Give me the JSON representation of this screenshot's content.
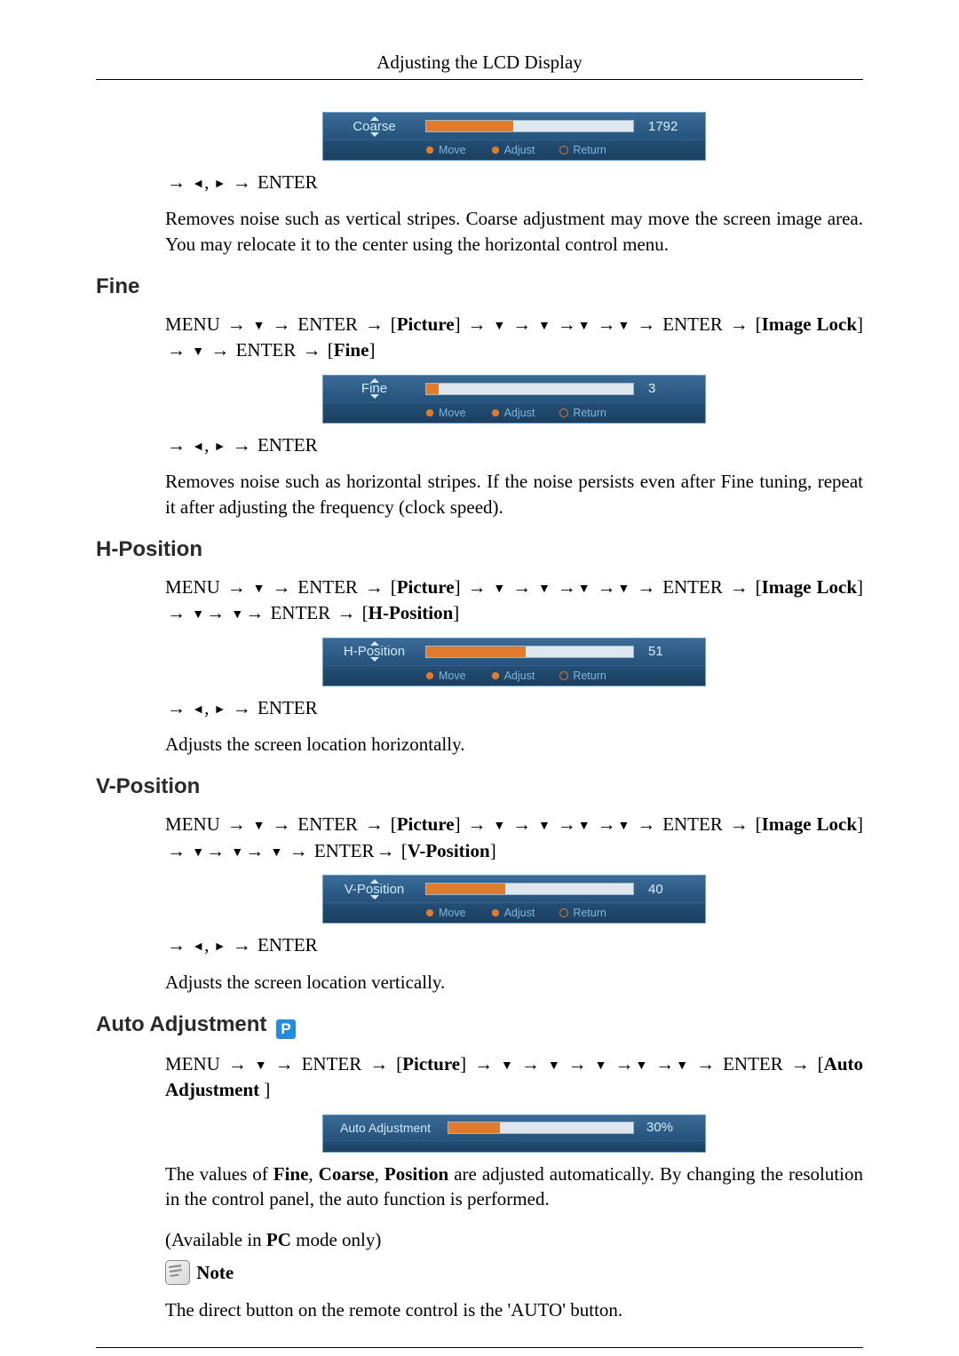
{
  "header": {
    "title": "Adjusting the LCD Display"
  },
  "glyphs": {
    "arrow_right": "→",
    "tri_down": "▼",
    "tri_left": "◄",
    "tri_right": "►",
    "comma": ","
  },
  "common": {
    "menu": "MENU",
    "enter": "ENTER",
    "picture": "Picture",
    "image_lock": "Image Lock"
  },
  "osd_hints": {
    "move": "Move",
    "adjust": "Adjust",
    "ret": "Return"
  },
  "coarse": {
    "osd": {
      "label": "Coarse",
      "value": "1792",
      "fill_pct": 42
    },
    "post_enter": "ENTER",
    "desc": "Removes noise such as vertical stripes. Coarse adjustment may move the screen image area. You may relocate it to the center using the horizontal control menu."
  },
  "fine": {
    "heading": "Fine",
    "bracket": "Fine",
    "osd": {
      "label": "Fine",
      "value": "3",
      "fill_pct": 6
    },
    "post_enter": "ENTER",
    "desc": "Removes noise such as horizontal stripes. If the noise persists even after Fine tuning, repeat it after adjusting the frequency (clock speed)."
  },
  "hpos": {
    "heading": "H-Position",
    "bracket": "H-Position",
    "osd": {
      "label": "H-Position",
      "value": "51",
      "fill_pct": 48
    },
    "post_enter": "ENTER",
    "desc": "Adjusts the screen location horizontally."
  },
  "vpos": {
    "heading": "V-Position",
    "bracket": "V-Position",
    "osd": {
      "label": "V-Position",
      "value": "40",
      "fill_pct": 38
    },
    "post_enter": "ENTER",
    "desc": "Adjusts the screen location vertically."
  },
  "auto": {
    "heading": "Auto Adjustment",
    "bracket": "Auto Adjustment ",
    "osd": {
      "label": "Auto Adjustment",
      "value": "30%",
      "fill_pct": 28
    },
    "desc_pre": "The values of ",
    "desc_b1": "Fine",
    "desc_mid1": ", ",
    "desc_b2": "Coarse",
    "desc_mid2": ", ",
    "desc_b3": "Position",
    "desc_post": " are adjusted automatically. By changing the resolution in the control panel, the auto function is performed.",
    "pc_pre": "(Available in ",
    "pc_b": "PC",
    "pc_post": " mode only)",
    "note_label": "Note",
    "note_text": "The direct button on the remote control is the 'AUTO' button."
  }
}
